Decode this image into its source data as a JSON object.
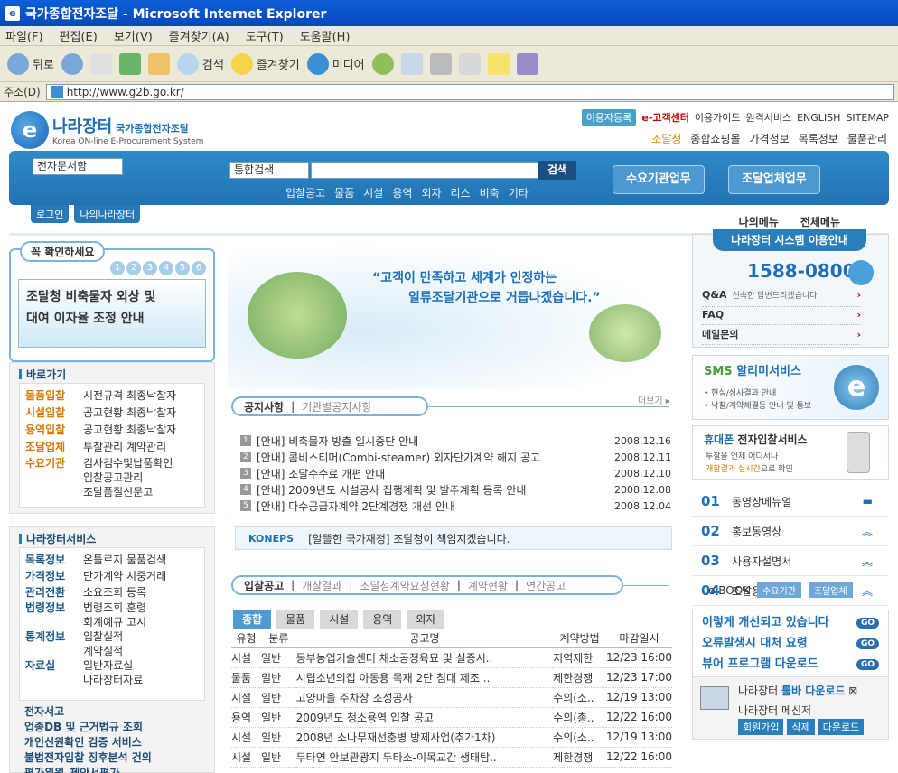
{
  "window": {
    "title": "국가종합전자조달 - Microsoft Internet Explorer"
  },
  "menubar": [
    "파일(F)",
    "편집(E)",
    "보기(V)",
    "즐겨찾기(A)",
    "도구(T)",
    "도움말(H)"
  ],
  "toolbar": {
    "back": "뒤로",
    "search": "검색",
    "favorites": "즐겨찾기",
    "media": "미디어"
  },
  "address": {
    "label": "주소(D)",
    "url": "http://www.g2b.go.kr/"
  },
  "site": {
    "logo_main": "나라장터",
    "logo_tag": "국가종합전자조달",
    "logo_sub": "Korea ON-line E-Procurement System",
    "toplinks": {
      "register": "이용자등록",
      "ecenter": "e-고객센터",
      "guide": "이용가이드",
      "remote": "원격서비스",
      "english": "ENGLISH",
      "sitemap": "SITEMAP"
    },
    "secondlinks": [
      "조달청",
      "종합쇼핑몰",
      "가격정보",
      "목록정보",
      "물품관리"
    ],
    "search": {
      "scope": "전자문서함",
      "type": "통합검색",
      "button": "검색"
    },
    "quick": [
      "입찰공고",
      "물품",
      "시설",
      "용역",
      "외자",
      "리스",
      "비축",
      "기타"
    ],
    "buttons": {
      "buyer": "수요기관업무",
      "supplier": "조달업체업무"
    },
    "loginbar": [
      "로그인",
      "나의나라장터"
    ],
    "mymenu": [
      "나의메뉴",
      "전체메뉴"
    ]
  },
  "check": {
    "title": "꼭 확인하세요",
    "pages": [
      "1",
      "2",
      "3",
      "4",
      "5",
      "6"
    ],
    "banner_line1": "조달청 비축물자 외상 및",
    "banner_line2": "대여 이자율 조정 안내"
  },
  "shortcuts": {
    "title": "바로가기",
    "rows": [
      {
        "k": "물품입찰",
        "v": "시전규격 최종낙찰자"
      },
      {
        "k": "시설입찰",
        "v": "공고현황 최종낙찰자"
      },
      {
        "k": "용역입찰",
        "v": "공고현황 최종낙찰자"
      },
      {
        "k": "조달업체",
        "v": "투찰관리 계약관리"
      },
      {
        "k": "수요기관",
        "v": "검사검수및납품확인"
      },
      {
        "k": "",
        "v": "입찰공고관리"
      },
      {
        "k": "",
        "v": "조달품질신문고"
      }
    ]
  },
  "services": {
    "title": "나라장터서비스",
    "rows": [
      {
        "k": "목록정보",
        "v": "온톨로지 물품검색"
      },
      {
        "k": "가격정보",
        "v": "단가계약 시중거래"
      },
      {
        "k": "관리전환",
        "v": "소요조회 등록"
      },
      {
        "k": "법령정보",
        "v": "법령조회 훈령"
      },
      {
        "k": "",
        "v": "회계예규 고시"
      },
      {
        "k": "통계정보",
        "v": "입찰실적"
      },
      {
        "k": "",
        "v": "계약실적"
      },
      {
        "k": "자료실",
        "v": "일반자료실"
      },
      {
        "k": "",
        "v": "나라장터자료"
      }
    ],
    "bullets": [
      "전자서고",
      "업종DB 및 근거법규 조회",
      "개인신원확인 검증 서비스",
      "불법전자입찰 징후분석 건의",
      "평가위원_제안서평가"
    ]
  },
  "hero": {
    "line1": "“고객이 만족하고 세계가 인정하는",
    "line2": "일류조달기관으로 거듭나겠습니다.”"
  },
  "notice": {
    "tab_on": "공지사항",
    "tab_off": "기관별공지사항",
    "more": "더보기 ▸",
    "items": [
      {
        "n": "1",
        "t": "[안내] 비축물자 방출 일시중단 안내",
        "d": "2008.12.16"
      },
      {
        "n": "2",
        "t": "[안내] 콤비스티머(Combi-steamer) 외자단가계약 해지 공고",
        "d": "2008.12.11"
      },
      {
        "n": "3",
        "t": "[안내] 조달수수료 개편 안내",
        "d": "2008.12.10"
      },
      {
        "n": "4",
        "t": "[안내] 2009년도 시설공사 집행계획 및 발주계획 등록 안내",
        "d": "2008.12.08"
      },
      {
        "n": "5",
        "t": "[안내] 다수공급자계약 2단계경쟁 개선 안내",
        "d": "2008.12.04"
      }
    ]
  },
  "koneps": {
    "label": "KONEPS",
    "text": "[알뜰한 국가재정] 조달청이 책임지겠습니다."
  },
  "bids": {
    "tabs": [
      "입찰공고",
      "개찰결과",
      "조달청계약요청현황",
      "계약현황",
      "연간공고"
    ],
    "subtabs": [
      "종합",
      "물품",
      "시설",
      "용역",
      "외자"
    ],
    "headers": [
      "유형",
      "분류",
      "공고명",
      "계약방법",
      "마감일시"
    ],
    "rows": [
      [
        "시설",
        "일반",
        "동부농업기술센터 채소공정육묘 및 실증시..",
        "지역제한",
        "12/23 16:00"
      ],
      [
        "물품",
        "일반",
        "시립소년의집 아동용 목재 2단 침대 제조 ..",
        "제한경쟁",
        "12/23 17:00"
      ],
      [
        "시설",
        "일반",
        "고양마을 주차장 조성공사",
        "수의(소..",
        "12/19 13:00"
      ],
      [
        "용역",
        "일반",
        "2009년도 청소용역 입찰 공고",
        "수의(총..",
        "12/22 16:00"
      ],
      [
        "시설",
        "일반",
        "2008년 소나무재선충병 방제사업(추가1차)",
        "수의(소..",
        "12/19 13:00"
      ],
      [
        "시설",
        "일반",
        "두타연 안보관광지 두타소-이목교간 생태탐..",
        "제한경쟁",
        "12/22 16:00"
      ]
    ]
  },
  "help": {
    "title": "나라장터 시스템 이용안내",
    "tel": "1588-0800",
    "qa": "Q&A",
    "qa_sub": "신속한 답변드리겠습니다.",
    "faq": "FAQ",
    "mail": "메일문의"
  },
  "sms": {
    "title_a": "SMS",
    "title_b": "알리미서비스",
    "line1": "• 현실/심사결과 안내",
    "line2": "• 낙찰/계약체결등 안내 및 통보"
  },
  "phone": {
    "title_a": "휴대폰",
    "title_b": "전자입찰서비스",
    "line1": "투찰을 언제 어디서나",
    "line2a": "개찰결과 실시간",
    "line2b": "으로 확인"
  },
  "nlist": [
    {
      "no": "01",
      "t": "동영상메뉴얼"
    },
    {
      "no": "02",
      "t": "홍보동영상"
    },
    {
      "no": "03",
      "t": "사용자설명서"
    },
    {
      "no": "04",
      "t": "조달용어사전"
    }
  ],
  "ebook": {
    "label": "e-BOOK",
    "b1": "수요기관",
    "b2": "조달업체"
  },
  "glinks": [
    "이렇게 개선되고 있습니다",
    "오류발생시 대처 요령",
    "뷰어 프로그램 다운로드"
  ],
  "tray": {
    "t1a": "나라장터",
    "t1b": "툴바 다운로드",
    "t2": "나라장터 메신저",
    "b1": "회원가입",
    "b2": "삭제",
    "b3": "다운로드"
  }
}
